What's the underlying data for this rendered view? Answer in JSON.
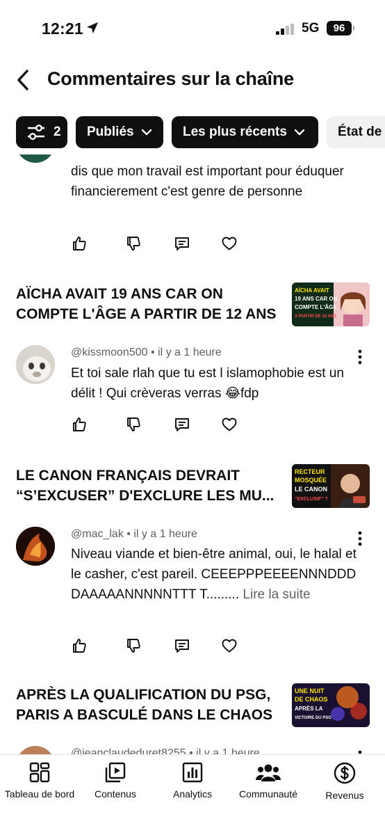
{
  "status_bar": {
    "time": "12:21",
    "network": "5G",
    "battery": "96"
  },
  "header": {
    "title": "Commentaires sur la chaîne"
  },
  "filters": {
    "count": "2",
    "published": "Publiés",
    "sort": "Les plus récents",
    "state": "État de"
  },
  "comment0": {
    "text": "dis que mon travail est important pour éduquer financierement c'est genre de personne"
  },
  "video1": {
    "title": "AÏCHA AVAIT 19 ANS CAR ON COMPTE L'ÂGE A PARTIR DE 12 ANS",
    "thumb_lines": [
      "AÏCHA AVAIT",
      "19 ANS CAR ON",
      "COMPTE L'ÂGE",
      "A PARTIR DE 12 ANS"
    ]
  },
  "comment1": {
    "author": "@kissmoon500",
    "time": "il y a 1 heure",
    "text": "Et toi sale rlah que tu est l islamophobie est un délit ! Qui crèveras verras 😂fdp"
  },
  "video2": {
    "title": "LE CANON FRANÇAIS DEVRAIT “S’EXCUSER” D'EXCLURE LES MU...",
    "thumb_lines": [
      "RECTEUR",
      "MOSQUÉE",
      "LE CANON",
      "“EXCLUSIF” ?"
    ]
  },
  "comment2": {
    "author": "@mac_lak",
    "time": "il y a 1 heure",
    "text": "Niveau viande et bien-être animal, oui, le halal et le casher, c'est pareil. CEEEPPPEEEENNNDDDDAAAAANNNNNTTT T.........",
    "read_more": "Lire la suite"
  },
  "video3": {
    "title": "APRÈS LA QUALIFICATION DU PSG, PARIS A BASCULÉ DANS LE CHAOS",
    "thumb_lines": [
      "UNE NUIT",
      "DE CHAOS",
      "APRÈS LA",
      "VICTOIRE DU PSG"
    ]
  },
  "comment3": {
    "author": "@jeanclaudeduret8255",
    "time": "il y a 1 heure"
  },
  "meta_sep": "•",
  "bottom_nav": [
    {
      "label": "Tableau de bord",
      "icon": "dashboard-icon"
    },
    {
      "label": "Contenus",
      "icon": "content-icon"
    },
    {
      "label": "Analytics",
      "icon": "analytics-icon"
    },
    {
      "label": "Communauté",
      "icon": "community-icon"
    },
    {
      "label": "Revenus",
      "icon": "dollar-icon"
    }
  ]
}
